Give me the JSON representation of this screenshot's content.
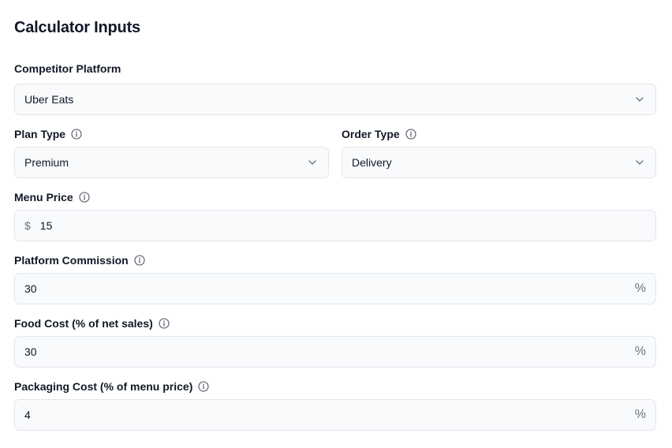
{
  "title": "Calculator Inputs",
  "competitor": {
    "label": "Competitor Platform",
    "value": "Uber Eats"
  },
  "plan_type": {
    "label": "Plan Type",
    "value": "Premium"
  },
  "order_type": {
    "label": "Order Type",
    "value": "Delivery"
  },
  "menu_price": {
    "label": "Menu Price",
    "prefix": "$",
    "value": "15"
  },
  "commission": {
    "label": "Platform Commission",
    "value": "30",
    "suffix": "%"
  },
  "food_cost": {
    "label": "Food Cost (% of net sales)",
    "value": "30",
    "suffix": "%"
  },
  "packaging_cost": {
    "label": "Packaging Cost (% of menu price)",
    "value": "4",
    "suffix": "%"
  },
  "icons": {
    "info": "info-icon",
    "dropdown": "chevron-down-icon"
  },
  "colors": {
    "field_bg": "#f8fafc",
    "field_border": "#e2e6ec",
    "muted": "#6b7280",
    "text": "#111827"
  }
}
